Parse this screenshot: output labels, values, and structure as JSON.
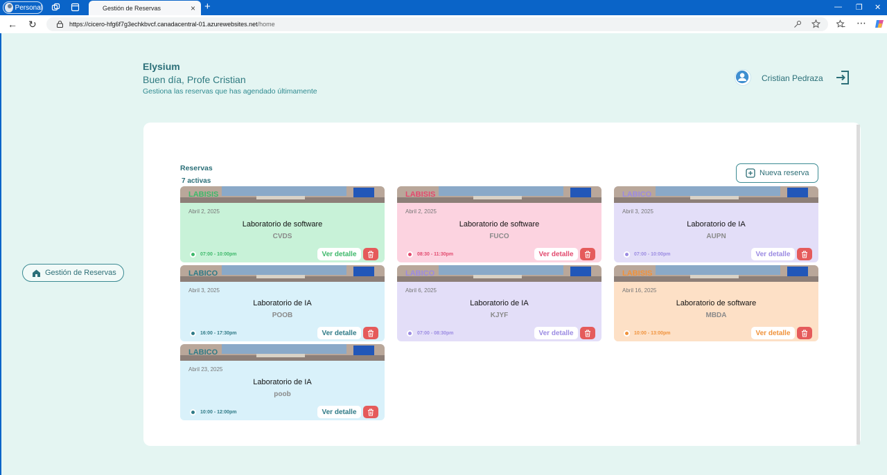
{
  "browser": {
    "profile_label": "Personal",
    "tab_title": "Gestión de Reservas",
    "url_host": "https://cicero-hfg6f7g3echkbvcf.canadacentral-01.azurewebsites.net",
    "url_path": "/home"
  },
  "header": {
    "brand": "Elysium",
    "greeting": "Buen día, Profe Cristian",
    "subtitle": "Gestiona las reservas que has agendado últimamente",
    "user_name": "Cristian Pedraza"
  },
  "sidebar": {
    "nav_label": "Gestión de Reservas"
  },
  "reservations": {
    "title": "Reservas",
    "count_label": "7 activas",
    "new_button_label": "Nueva reserva",
    "detail_label": "Ver detalle",
    "items": [
      {
        "lab": "LABISIS",
        "date": "Abril 2, 2025",
        "room": "Laboratorio de software",
        "code": "CVDS",
        "time": "07:00 - 10:00pm",
        "theme": "green"
      },
      {
        "lab": "LABISIS",
        "date": "Abril 2, 2025",
        "room": "Laboratorio de software",
        "code": "FUCO",
        "time": "08:30 - 11:30pm",
        "theme": "pink"
      },
      {
        "lab": "LABICO",
        "date": "Abril 3, 2025",
        "room": "Laboratorio de IA",
        "code": "AUPN",
        "time": "07:00 - 10:00pm",
        "theme": "lavender"
      },
      {
        "lab": "LABICO",
        "date": "Abril 3, 2025",
        "room": "Laboratorio de IA",
        "code": "POOB",
        "time": "16:00 - 17:30pm",
        "theme": "blue"
      },
      {
        "lab": "LABICO",
        "date": "Abril 6, 2025",
        "room": "Laboratorio de IA",
        "code": "KJYF",
        "time": "07:00 - 08:30pm",
        "theme": "lavender"
      },
      {
        "lab": "LABISIS",
        "date": "Abril 16, 2025",
        "room": "Laboratorio de software",
        "code": "MBDA",
        "time": "10:00 - 13:00pm",
        "theme": "orange"
      },
      {
        "lab": "LABICO",
        "date": "Abril 23, 2025",
        "room": "Laboratorio de IA",
        "code": "poob",
        "time": "10:00 - 12:00pm",
        "theme": "blue"
      }
    ]
  },
  "colors": {
    "green": {
      "bg": "#c8f2d8",
      "accent": "#3db86a"
    },
    "pink": {
      "bg": "#fcd3e0",
      "accent": "#e24a6e"
    },
    "lavender": {
      "bg": "#e3def8",
      "accent": "#9b8be2"
    },
    "blue": {
      "bg": "#d9f1fa",
      "accent": "#2f7a86"
    },
    "orange": {
      "bg": "#fde0c6",
      "accent": "#f0923b"
    },
    "brand": "#2b6f78",
    "trash": "#e55b5b"
  },
  "icons": {
    "nav": "house-icon",
    "new": "plus-square-icon",
    "logout": "logout-icon",
    "delete": "trash-icon",
    "avatar": "user-avatar-icon"
  }
}
